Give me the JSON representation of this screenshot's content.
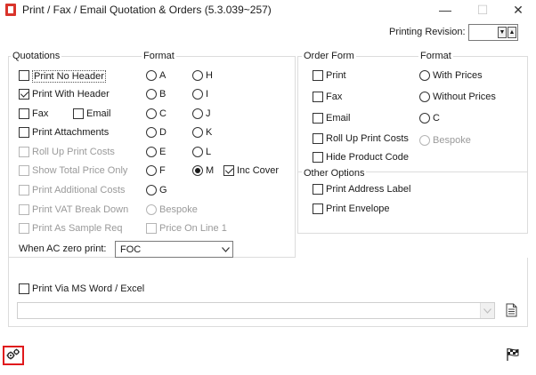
{
  "window": {
    "title": "Print / Fax / Email Quotation & Orders (5.3.039~257)",
    "minimize_glyph": "—",
    "maximize_glyph": "☐",
    "close_glyph": "✕"
  },
  "printing_revision": {
    "label": "Printing Revision:",
    "value": ""
  },
  "quotations": {
    "legend": "Quotations",
    "print_no_header": "Print No Header",
    "print_with_header": "Print With Header",
    "fax": "Fax",
    "email": "Email",
    "print_attachments": "Print Attachments",
    "roll_up_print_costs": "Roll Up Print Costs",
    "show_total_price_only": "Show Total Price Only",
    "print_additional_costs": "Print Additional Costs",
    "print_vat_break_down": "Print VAT Break Down",
    "print_as_sample_req": "Print As Sample Req"
  },
  "format": {
    "legend": "Format",
    "a": "A",
    "b": "B",
    "c": "C",
    "d": "D",
    "e": "E",
    "f": "F",
    "g": "G",
    "h": "H",
    "i": "I",
    "j": "J",
    "k": "K",
    "l": "L",
    "m": "M",
    "inc_cover": "Inc Cover",
    "bespoke": "Bespoke",
    "price_on_line_1": "Price On Line 1"
  },
  "ac_zero": {
    "label": "When AC zero print:",
    "value": "FOC"
  },
  "order_form": {
    "legend": "Order Form",
    "print": "Print",
    "fax": "Fax",
    "email": "Email",
    "roll_up_print_costs": "Roll Up Print Costs",
    "hide_product_code": "Hide Product Code"
  },
  "order_format": {
    "legend": "Format",
    "with_prices": "With Prices",
    "without_prices": "Without Prices",
    "c": "C",
    "bespoke": "Bespoke"
  },
  "other_options": {
    "legend": "Other Options",
    "print_address_label": "Print Address Label",
    "print_envelope": "Print Envelope"
  },
  "ms_word": {
    "label": "Print Via MS Word / Excel",
    "path": ""
  },
  "colors": {
    "highlight": "#e0191c",
    "app_icon": "#d9342b"
  }
}
